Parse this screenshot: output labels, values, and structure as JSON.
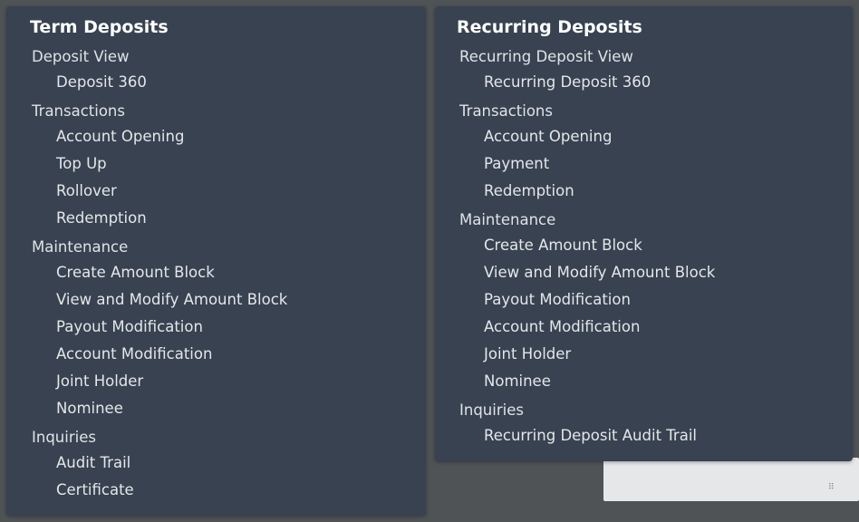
{
  "term": {
    "title": "Term Deposits",
    "sections": [
      {
        "label": "Deposit View",
        "items": [
          "Deposit 360"
        ]
      },
      {
        "label": "Transactions",
        "items": [
          "Account Opening",
          "Top Up",
          "Rollover",
          "Redemption"
        ]
      },
      {
        "label": "Maintenance",
        "items": [
          "Create Amount Block",
          "View and Modify Amount Block",
          "Payout Modification",
          "Account Modification",
          "Joint Holder",
          "Nominee"
        ]
      },
      {
        "label": "Inquiries",
        "items": [
          "Audit Trail",
          "Certificate"
        ]
      }
    ]
  },
  "recurring": {
    "title": "Recurring Deposits",
    "sections": [
      {
        "label": "Recurring Deposit View",
        "items": [
          "Recurring Deposit 360"
        ]
      },
      {
        "label": "Transactions",
        "items": [
          "Account Opening",
          "Payment",
          "Redemption"
        ]
      },
      {
        "label": "Maintenance",
        "items": [
          "Create Amount Block",
          "View and Modify Amount Block",
          "Payout Modification",
          "Account Modification",
          "Joint Holder",
          "Nominee"
        ]
      },
      {
        "label": "Inquiries",
        "items": [
          "Recurring Deposit Audit Trail"
        ]
      }
    ]
  },
  "background": {
    "grip_glyph": "⠿"
  },
  "colors": {
    "panel": "#384250",
    "backdrop": "#4f5356",
    "title": "#ffffff",
    "text": "#e4e7ea"
  }
}
